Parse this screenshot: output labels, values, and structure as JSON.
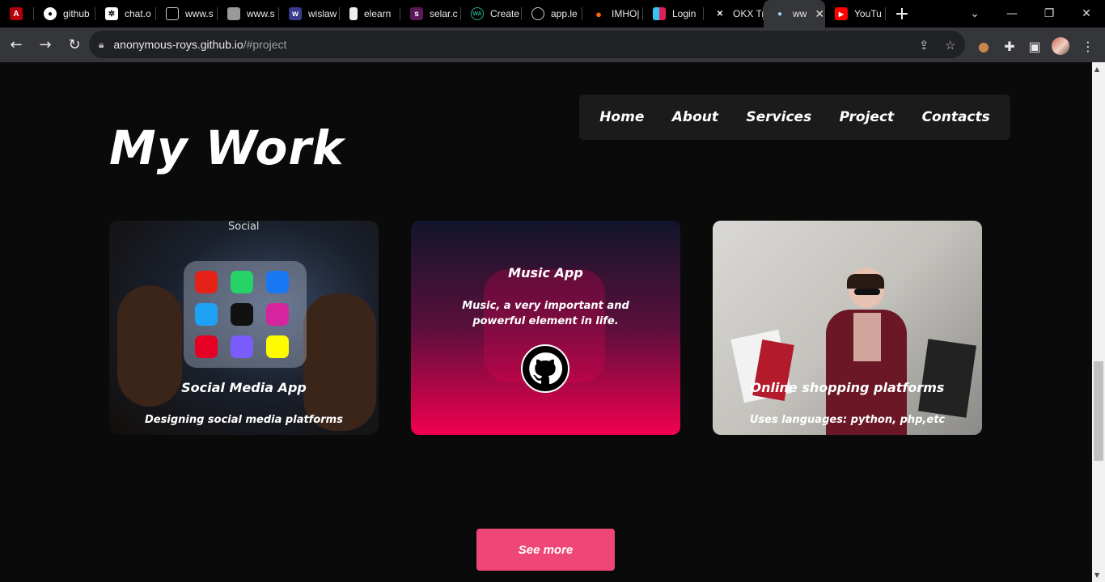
{
  "browser": {
    "tabs": [
      {
        "label": "",
        "icon": "acrobat-icon"
      },
      {
        "label": "github",
        "icon": "github-icon"
      },
      {
        "label": "chat.o",
        "icon": "openai-icon"
      },
      {
        "label": "www.s",
        "icon": "window-icon"
      },
      {
        "label": "www.s",
        "icon": "cube-icon"
      },
      {
        "label": "wislaw",
        "icon": "wislaw-icon"
      },
      {
        "label": "elearn",
        "icon": "document-icon"
      },
      {
        "label": "selar.c",
        "icon": "selar-icon"
      },
      {
        "label": "Create",
        "icon": "wa-icon"
      },
      {
        "label": "app.le",
        "icon": "globe-icon"
      },
      {
        "label": "IMHO|",
        "icon": "fire-icon"
      },
      {
        "label": "Login",
        "icon": "slack-icon"
      },
      {
        "label": "OKX Tr",
        "icon": "okx-icon"
      },
      {
        "label": "ww",
        "icon": "person-icon",
        "active": true
      },
      {
        "label": "YouTu",
        "icon": "youtube-icon"
      }
    ],
    "url_host": "anonymous-roys.github.io",
    "url_path": "/#project"
  },
  "page": {
    "title": "My Work",
    "nav": [
      "Home",
      "About",
      "Services",
      "Project",
      "Contacts"
    ],
    "cards": [
      {
        "title": "Social Media App",
        "description": "Designing social media platforms"
      },
      {
        "title": "Music App",
        "description": "Music, a very important and powerful element in life."
      },
      {
        "title": "Online shopping platforms",
        "description": "Uses languages: python, php,etc"
      }
    ],
    "social_header": "Social",
    "see_more_label": "See more"
  },
  "colors": {
    "background": "#0a0a0a",
    "accent": "#ef4678",
    "nav_bg": "#1b1b1b"
  }
}
